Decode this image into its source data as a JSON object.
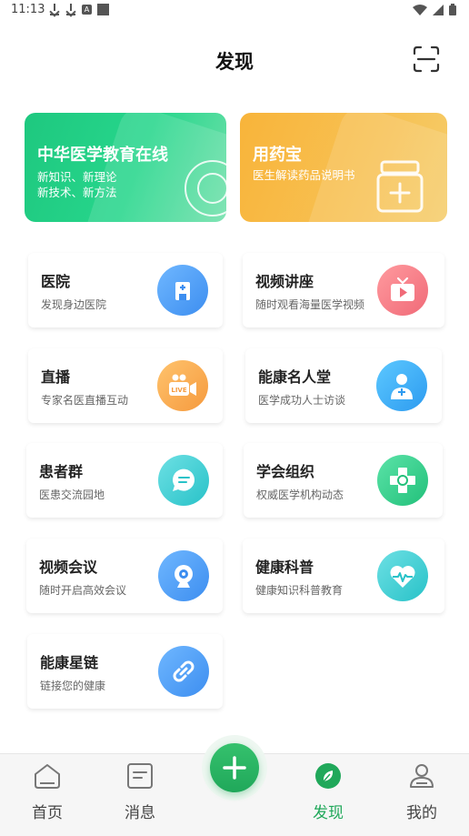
{
  "status_bar": {
    "time": "11:13"
  },
  "header": {
    "title": "发现"
  },
  "banners": [
    {
      "title": "中华医学教育在线",
      "lines": [
        "新知识、新理论",
        "新技术、新方法"
      ]
    },
    {
      "title": "用药宝",
      "lines": [
        "医生解读药品说明书"
      ]
    }
  ],
  "cards": [
    {
      "title": "医院",
      "subtitle": "发现身边医院",
      "icon": "hospital-icon"
    },
    {
      "title": "视频讲座",
      "subtitle": "随时观看海量医学视频",
      "icon": "tv-play-icon"
    },
    {
      "title": "直播",
      "subtitle": "专家名医直播互动",
      "icon": "live-camera-icon"
    },
    {
      "title": "能康名人堂",
      "subtitle": "医学成功人士访谈",
      "icon": "doctor-icon"
    },
    {
      "title": "患者群",
      "subtitle": "医患交流园地",
      "icon": "chat-icon"
    },
    {
      "title": "学会组织",
      "subtitle": "权威医学机构动态",
      "icon": "medical-cross-icon"
    },
    {
      "title": "视频会议",
      "subtitle": "随时开启高效会议",
      "icon": "webcam-icon"
    },
    {
      "title": "健康科普",
      "subtitle": "健康知识科普教育",
      "icon": "heartbeat-icon"
    },
    {
      "title": "能康星链",
      "subtitle": "链接您的健康",
      "icon": "link-icon"
    }
  ],
  "tabbar": {
    "items": [
      {
        "label": "首页",
        "icon": "home-icon"
      },
      {
        "label": "消息",
        "icon": "message-icon"
      },
      {
        "label": "发现",
        "icon": "discover-leaf-icon",
        "active": true
      },
      {
        "label": "我的",
        "icon": "profile-icon"
      }
    ],
    "center_button": {
      "icon": "plus-icon"
    }
  },
  "colors": {
    "accent": "#20a85a",
    "green_banner": "#27d68c",
    "orange_banner": "#f7c153"
  }
}
